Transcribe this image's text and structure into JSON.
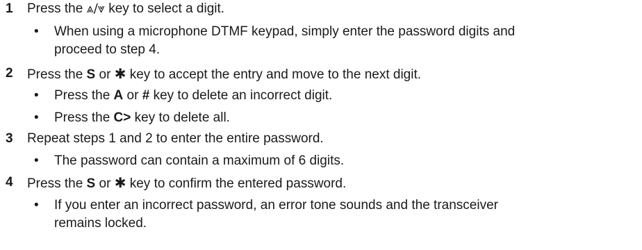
{
  "steps": [
    {
      "number": "1",
      "parts": [
        "Press the ",
        "⩓/⩔",
        " key to select a digit."
      ],
      "bullets": [
        {
          "line1": "When using a microphone DTMF keypad, simply enter the password digits and",
          "line2": "proceed to step 4."
        }
      ]
    },
    {
      "number": "2",
      "parts": [
        "Press the ",
        "S",
        " or ",
        "✱",
        " key to accept the entry and move to the next digit."
      ],
      "bullets": [
        {
          "parts": [
            "Press the ",
            "A",
            " or ",
            "#",
            " key to delete an incorrect digit."
          ]
        },
        {
          "parts": [
            "Press the ",
            "C>",
            " key to delete all."
          ]
        }
      ]
    },
    {
      "number": "3",
      "text": "Repeat steps 1 and 2 to enter the entire password.",
      "bullets": [
        {
          "text": "The password can contain a maximum of 6 digits."
        }
      ]
    },
    {
      "number": "4",
      "parts": [
        "Press the ",
        "S",
        " or ",
        "✱",
        " key to confirm the entered password."
      ],
      "bullets": [
        {
          "line1": "If you enter an incorrect password, an error tone sounds and the transceiver",
          "line2": "remains locked."
        }
      ]
    }
  ],
  "bullet_glyph": "•"
}
